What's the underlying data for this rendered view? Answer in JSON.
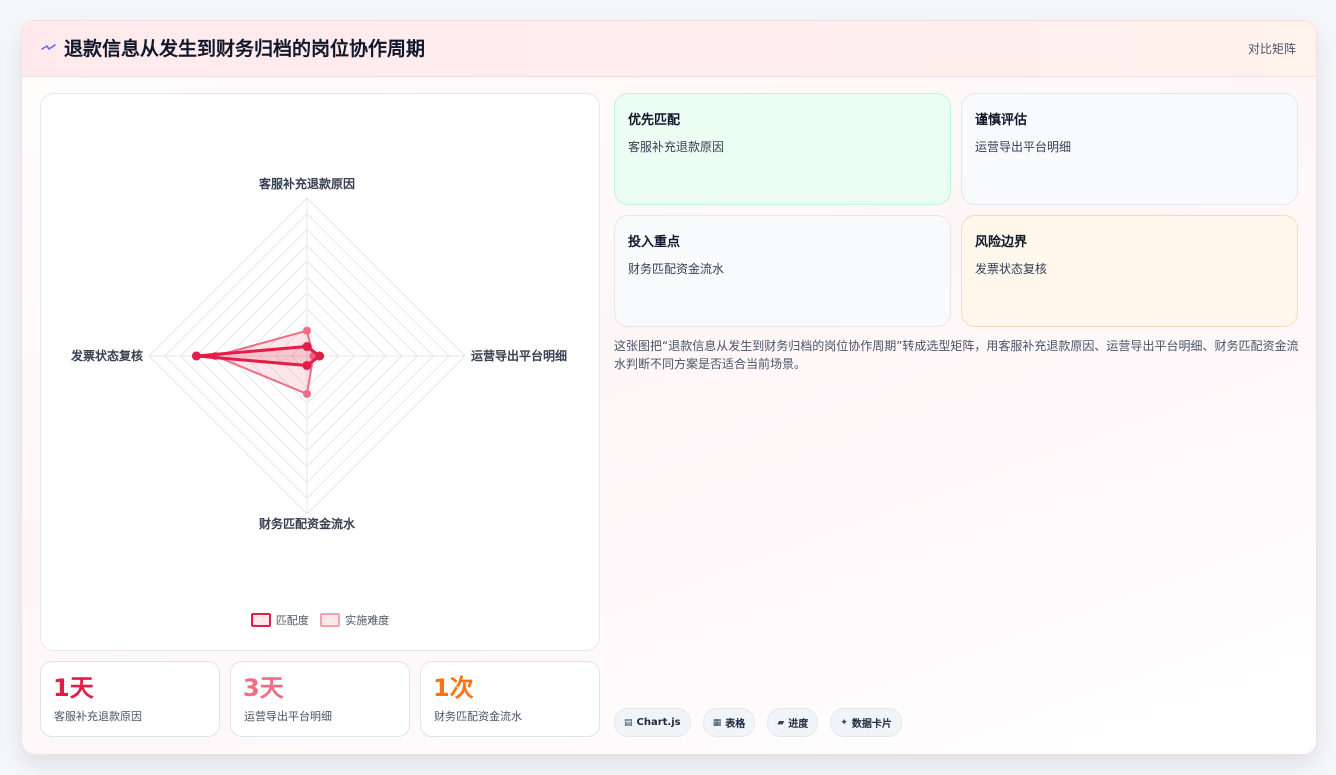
{
  "header": {
    "title": "退款信息从发生到财务归档的岗位协作周期",
    "tag": "对比矩阵",
    "icon": "lightning-icon"
  },
  "colors": {
    "accent": "#e11d48",
    "secondary": "#f43f5e",
    "warning": "#f97316"
  },
  "chart_data": {
    "type": "radar",
    "axes": [
      "客服补充退款原因",
      "运营导出平台明细",
      "财务匹配资金流水",
      "发票状态复核"
    ],
    "range": [
      0,
      10
    ],
    "series": [
      {
        "name": "匹配度",
        "values": [
          0.6,
          0.8,
          0.6,
          7.0
        ],
        "color": "#e11d48"
      },
      {
        "name": "实施难度",
        "values": [
          1.6,
          0.4,
          2.4,
          5.8
        ],
        "color": "#f06d85"
      }
    ],
    "grid": true,
    "legend": "bottom"
  },
  "stats": [
    {
      "value": "1天",
      "label": "客服补充退款原因",
      "color": "#e11d48"
    },
    {
      "value": "3天",
      "label": "运营导出平台明细",
      "color": "#f06d85"
    },
    {
      "value": "1次",
      "label": "财务匹配资金流水",
      "color": "#f97316"
    }
  ],
  "quadrants": [
    {
      "title": "优先匹配",
      "text": "客服补充退款原因",
      "bg": "#ecfdf3",
      "border": "#bbf7d0"
    },
    {
      "title": "谨慎评估",
      "text": "运营导出平台明细",
      "bg": "#f8fafc",
      "border": "#e2e8f0"
    },
    {
      "title": "投入重点",
      "text": "财务匹配资金流水",
      "bg": "#f8fafc",
      "border": "#e2e8f0"
    },
    {
      "title": "风险边界",
      "text": "发票状态复核",
      "bg": "#fff7ec",
      "border": "#fcd9b6"
    }
  ],
  "description": "这张图把“退款信息从发生到财务归档的岗位协作周期”转成选型矩阵，用客服补充退款原因、运营导出平台明细、财务匹配资金流水判断不同方案是否适合当前场景。",
  "tags": [
    {
      "icon": "chart-icon",
      "glyph": "▤",
      "label": "Chart.js"
    },
    {
      "icon": "table-icon",
      "glyph": "▦",
      "label": "表格"
    },
    {
      "icon": "progress-icon",
      "glyph": "▰",
      "label": "进度"
    },
    {
      "icon": "spark-icon",
      "glyph": "✦",
      "label": "数据卡片"
    }
  ]
}
